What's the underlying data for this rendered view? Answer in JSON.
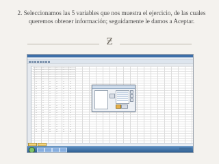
{
  "caption": {
    "line1": "2. Seleccionamos las 5 variables que nos muestra el ejercicio, de las cuales",
    "line2": "queremos obtener información; seguidamente le damos a Aceptar."
  },
  "ornament": {
    "icon": "ornament-z-icon",
    "glyph": "Ƶ"
  },
  "screenshot": {
    "app": "spreadsheet-style data editor",
    "dialog": {
      "accept_color": "#e6b04b"
    }
  },
  "colors": {
    "background": "#f4f2ee",
    "caption_text": "#4a4a4a",
    "taskbar": "#2f5f93"
  }
}
